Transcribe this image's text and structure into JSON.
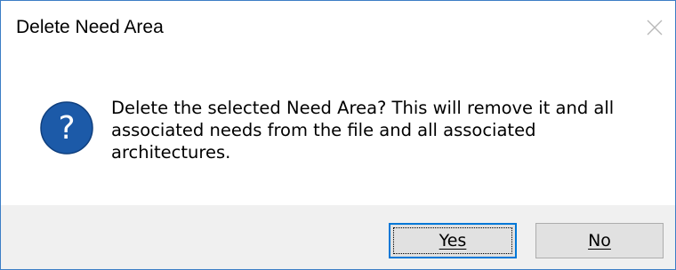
{
  "dialog": {
    "title": "Delete Need Area",
    "message_lines": [
      "Delete the selected Need Area?  This will remove it and all",
      "associated needs from the file and all associated",
      "architectures."
    ],
    "icons": {
      "close": "close-icon",
      "question": "question-icon"
    },
    "buttons": {
      "yes_label": "Yes",
      "no_label": "No"
    },
    "colors": {
      "border": "#3c7ec6",
      "icon_fill": "#1c5aa8",
      "footer_bg": "#f0f0f0",
      "button_bg": "#e1e1e1",
      "default_button_border": "#0078d7"
    }
  }
}
